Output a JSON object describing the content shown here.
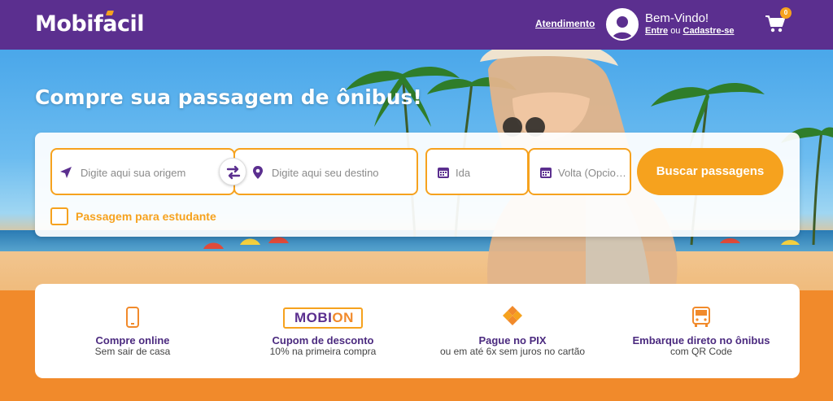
{
  "header": {
    "logo": "Mobifacil",
    "atendimento": "Atendimento",
    "welcome": "Bem-Vindo!",
    "login": "Entre",
    "or": "ou",
    "signup": "Cadastre-se",
    "cart_count": "0"
  },
  "hero": {
    "title": "Compre sua passagem de ônibus!"
  },
  "search": {
    "origin_placeholder": "Digite aqui sua origem",
    "destination_placeholder": "Digite aqui seu destino",
    "departure_placeholder": "Ida",
    "return_placeholder": "Volta (Opcional)",
    "search_button": "Buscar passagens",
    "student_label": "Passagem para estudante"
  },
  "features": [
    {
      "title": "Compre online",
      "subtitle": "Sem sair de casa",
      "icon": "phone-icon"
    },
    {
      "title": "Cupom de desconto",
      "subtitle": "10% na primeira compra",
      "icon": "mobion-ticket-icon",
      "badge_a": "MOBI",
      "badge_b": "ON"
    },
    {
      "title": "Pague no PIX",
      "subtitle": "ou em até 6x sem juros no cartão",
      "icon": "pix-icon"
    },
    {
      "title": "Embarque direto no ônibus",
      "subtitle": "com QR Code",
      "icon": "bus-icon"
    }
  ],
  "colors": {
    "purple": "#5b2f8f",
    "orange": "#f6a21e",
    "orange_dark": "#f18a2b"
  }
}
